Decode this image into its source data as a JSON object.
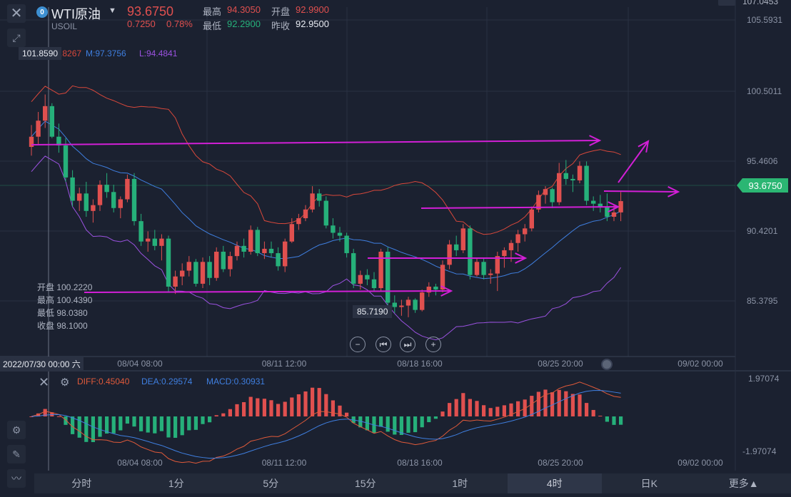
{
  "header": {
    "symbol_name": "WTI原油",
    "symbol_code": "USOIL",
    "symbol_badge": "0",
    "price": "93.6750",
    "change": "0.7250",
    "change_pct": "0.78%",
    "high_label": "最高",
    "high_value": "94.3050",
    "open_label": "开盘",
    "open_value": "92.9900",
    "low_label": "最低",
    "low_value": "92.2900",
    "prev_close_label": "昨收",
    "prev_close_value": "92.9500"
  },
  "indicators": {
    "boll_u": "U:103.8267",
    "boll_m": "M:97.3756",
    "boll_l": "L:94.4841",
    "diff": "DIFF:0.45040",
    "dea": "DEA:0.29574",
    "macd": "MACD:0.30931"
  },
  "labels": {
    "hi_marker": "101.8590",
    "low_marker": "85.7190",
    "crosshair_date": "2022/07/30 00:00 六",
    "current_price_tag": "93.6750",
    "top_right_partial": "107.0453"
  },
  "ohlc_panel": {
    "open": "开盘 100.2220",
    "high": "最高 100.4390",
    "low": "最低 98.0380",
    "close": "收盘 98.1000"
  },
  "timeframes": [
    "分时",
    "1分",
    "5分",
    "15分",
    "1时",
    "4时",
    "日K",
    "更多▲"
  ],
  "active_timeframe": "4时",
  "colors": {
    "up": "#e0504f",
    "down": "#26b07a",
    "boll_upper": "#d9483b",
    "boll_mid": "#3f7fe0",
    "boll_lower": "#9b52e0",
    "annotation": "#d21fd6",
    "diff": "#e05a3a",
    "dea": "#3f7fe0"
  },
  "chart_data": {
    "type": "candlestick",
    "y_ticks": [
      "105.5931",
      "100.5011",
      "95.4606",
      "90.4201",
      "85.3795"
    ],
    "x_ticks": [
      "08/04 08:00",
      "08/11 12:00",
      "08/18 16:00",
      "08/25 20:00",
      "09/02 00:00"
    ],
    "macd_y_ticks": [
      "1.97074",
      "-1.97074"
    ],
    "candles": [
      [
        97.4,
        98.9,
        96.8,
        98.1
      ],
      [
        98.1,
        99.8,
        97.6,
        99.2
      ],
      [
        99.2,
        101.0,
        98.7,
        100.2
      ],
      [
        100.2,
        100.4,
        98.0,
        98.1
      ],
      [
        98.1,
        99.0,
        97.0,
        97.5
      ],
      [
        97.5,
        98.0,
        95.0,
        95.3
      ],
      [
        95.3,
        95.8,
        93.3,
        93.7
      ],
      [
        93.7,
        94.6,
        93.0,
        94.2
      ],
      [
        94.2,
        95.0,
        92.6,
        93.0
      ],
      [
        93.0,
        93.8,
        92.2,
        93.4
      ],
      [
        93.4,
        95.1,
        93.0,
        94.8
      ],
      [
        94.8,
        95.6,
        93.9,
        94.3
      ],
      [
        94.3,
        94.8,
        92.9,
        93.2
      ],
      [
        93.2,
        94.0,
        92.5,
        93.8
      ],
      [
        93.8,
        95.5,
        93.6,
        95.2
      ],
      [
        95.2,
        95.6,
        92.0,
        92.3
      ],
      [
        92.3,
        92.8,
        90.6,
        90.9
      ],
      [
        90.9,
        91.6,
        90.2,
        91.1
      ],
      [
        91.1,
        91.7,
        90.3,
        90.6
      ],
      [
        90.6,
        91.4,
        89.6,
        91.1
      ],
      [
        91.1,
        91.3,
        87.4,
        87.8
      ],
      [
        87.8,
        88.9,
        87.3,
        88.5
      ],
      [
        88.5,
        89.4,
        87.9,
        88.9
      ],
      [
        88.9,
        89.9,
        88.5,
        89.5
      ],
      [
        89.5,
        89.7,
        87.8,
        88.0
      ],
      [
        88.0,
        89.8,
        87.7,
        89.5
      ],
      [
        89.5,
        89.9,
        87.9,
        88.4
      ],
      [
        88.4,
        90.5,
        88.2,
        90.2
      ],
      [
        90.2,
        90.6,
        88.8,
        89.0
      ],
      [
        89.0,
        90.2,
        88.5,
        89.9
      ],
      [
        89.9,
        90.9,
        89.6,
        90.6
      ],
      [
        90.6,
        91.1,
        89.8,
        90.2
      ],
      [
        90.2,
        92.0,
        90.0,
        91.7
      ],
      [
        91.7,
        91.9,
        89.9,
        90.1
      ],
      [
        90.1,
        90.9,
        89.7,
        90.4
      ],
      [
        90.4,
        90.9,
        89.8,
        90.1
      ],
      [
        90.1,
        90.5,
        88.9,
        89.2
      ],
      [
        89.2,
        91.1,
        88.8,
        90.9
      ],
      [
        90.9,
        92.5,
        90.8,
        92.1
      ],
      [
        92.1,
        92.8,
        91.7,
        92.5
      ],
      [
        92.5,
        93.4,
        92.3,
        93.1
      ],
      [
        93.1,
        94.7,
        92.9,
        94.2
      ],
      [
        94.2,
        94.5,
        93.3,
        93.7
      ],
      [
        93.7,
        94.0,
        91.8,
        92.0
      ],
      [
        92.0,
        92.5,
        91.1,
        91.5
      ],
      [
        91.5,
        91.9,
        90.9,
        91.3
      ],
      [
        91.3,
        91.5,
        89.8,
        90.1
      ],
      [
        90.1,
        90.4,
        87.7,
        88.0
      ],
      [
        88.0,
        88.9,
        87.6,
        88.6
      ],
      [
        88.6,
        89.0,
        87.9,
        88.3
      ],
      [
        88.3,
        88.8,
        87.5,
        87.7
      ],
      [
        87.7,
        90.4,
        87.5,
        90.2
      ],
      [
        90.2,
        90.5,
        86.4,
        86.7
      ],
      [
        86.7,
        87.2,
        86.0,
        86.4
      ],
      [
        86.4,
        86.9,
        85.8,
        86.5
      ],
      [
        86.5,
        87.1,
        85.7,
        86.9
      ],
      [
        86.9,
        87.0,
        86.0,
        86.2
      ],
      [
        86.2,
        87.6,
        86.1,
        87.4
      ],
      [
        87.4,
        88.1,
        87.1,
        87.8
      ],
      [
        87.8,
        88.0,
        87.2,
        87.6
      ],
      [
        87.6,
        89.6,
        87.4,
        89.3
      ],
      [
        89.3,
        91.0,
        89.0,
        90.7
      ],
      [
        90.7,
        91.3,
        89.9,
        90.3
      ],
      [
        90.3,
        92.1,
        90.1,
        91.8
      ],
      [
        91.8,
        92.0,
        88.3,
        88.6
      ],
      [
        88.6,
        89.8,
        88.5,
        89.5
      ],
      [
        89.5,
        89.8,
        88.3,
        88.6
      ],
      [
        88.6,
        89.0,
        88.0,
        88.7
      ],
      [
        88.7,
        90.2,
        87.5,
        89.9
      ],
      [
        89.9,
        90.5,
        89.1,
        90.3
      ],
      [
        90.3,
        91.0,
        89.5,
        90.8
      ],
      [
        90.8,
        91.7,
        90.2,
        91.4
      ],
      [
        91.4,
        92.1,
        90.9,
        91.8
      ],
      [
        91.8,
        93.3,
        91.6,
        93.1
      ],
      [
        93.1,
        94.4,
        92.9,
        94.1
      ],
      [
        94.1,
        94.7,
        93.5,
        94.5
      ],
      [
        94.5,
        94.6,
        93.2,
        93.6
      ],
      [
        93.6,
        96.3,
        93.4,
        95.6
      ],
      [
        95.6,
        96.5,
        94.8,
        95.2
      ],
      [
        95.2,
        95.5,
        94.3,
        95.1
      ],
      [
        95.1,
        96.4,
        94.9,
        96.1
      ],
      [
        96.1,
        96.4,
        93.4,
        93.7
      ],
      [
        93.7,
        94.0,
        93.0,
        93.5
      ],
      [
        93.5,
        94.1,
        92.9,
        93.3
      ],
      [
        93.3,
        94.2,
        92.3,
        92.6
      ],
      [
        92.6,
        93.4,
        92.3,
        92.9
      ],
      [
        92.9,
        94.3,
        92.3,
        93.675
      ]
    ]
  }
}
